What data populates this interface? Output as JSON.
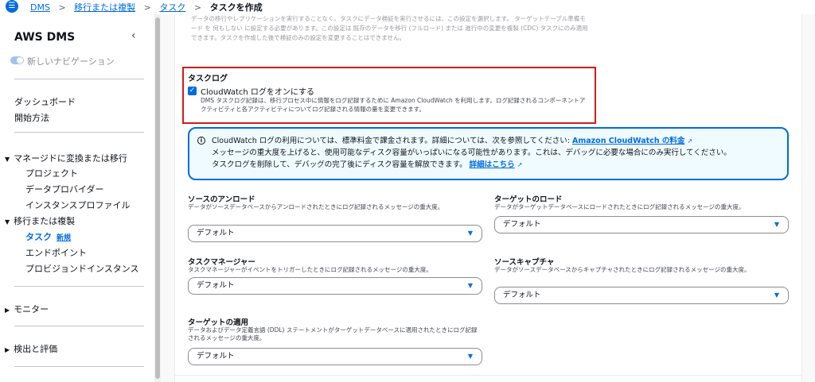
{
  "header": {
    "menu_icon": "hamburger-icon",
    "breadcrumbs": [
      "DMS",
      "移行または複製",
      "タスク"
    ],
    "current": "タスクを作成",
    "separator": ">"
  },
  "sidebar": {
    "title": "AWS DMS",
    "close_glyph": "‹",
    "new_nav_label": "新しいナビゲーション",
    "top_items": [
      "ダッシュボード",
      "開始方法"
    ],
    "group_convert": "マネージドに変換または移行",
    "convert_items": [
      "プロジェクト",
      "データプロバイダー",
      "インスタンスプロファイル"
    ],
    "group_migrate": "移行または複製",
    "migrate_active": "タスク",
    "badge_new": "新規",
    "migrate_items": [
      "エンドポイント",
      "プロビジョンドインスタンス"
    ],
    "group_monitor": "モニター",
    "group_discover": "検出と評価"
  },
  "faded_text": "データの移行やレプリケーションを実行することなく、タスクにデータ検証を実行させるには、この設定を選択します。 ターゲットテーブル準備モード を 何もしない に設定する必要があります。この設定は 既存のデータを移行 (フルロード) または 進行中の変更を複製 (CDC) タスクにのみ適用できます。タスクを作成した後で検証のみの設定を変更することはできません。",
  "task_log": {
    "title": "タスクログ",
    "checkbox_label": "CloudWatch ログをオンにする",
    "checked": true,
    "description": "DMS タスクログ記録は、移行プロセス中に情報をログ記録するために Amazon CloudWatch を利用します。ログ記録されるコンポーネントアクティビティと各アクティビティについてログ記録される情報の量を変更できます。"
  },
  "info_box": {
    "line1": "CloudWatch ログの利用については、標準料金で課金されます。詳細については、次を参照してください: ",
    "link1": "Amazon CloudWatch の料金",
    "line2": "メッセージの重大度を上げると、使用可能なディスク容量がいっぱいになる可能性があります。これは、デバッグに必要な場合にのみ実行してください。",
    "line3": "タスクログを削除して、デバッグの完了後にディスク容量を解放できます。",
    "link2": "詳細はこちら"
  },
  "fields": {
    "source_unload": {
      "label": "ソースのアンロード",
      "desc": "データがソースデータベースからアンロードされたときにログ記録されるメッセージの重大度。",
      "value": "デフォルト"
    },
    "target_load": {
      "label": "ターゲットのロード",
      "desc": "データがターゲットデータベースにロードされたときにログ記録されるメッセージの重大度。",
      "value": "デフォルト"
    },
    "task_manager": {
      "label": "タスクマネージャー",
      "desc": "タスクマネージャーがイベントをトリガーしたときにログ記録されるメッセージの重大度。",
      "value": "デフォルト"
    },
    "source_capture": {
      "label": "ソースキャプチャ",
      "desc": "データがソースデータベースからキャプチャされたときにログ記録されるメッセージの重大度。",
      "value": "デフォルト"
    },
    "target_apply": {
      "label": "ターゲットの適用",
      "desc": "データおよびデータ定義言語 (DDL) ステートメントがターゲットデータベースに適用されたときにログ記録されるメッセージの重大度。",
      "value": "デフォルト"
    }
  },
  "colors": {
    "accent": "#006ce0",
    "highlight": "#d31a1a",
    "info_bg": "#f0fbff"
  }
}
